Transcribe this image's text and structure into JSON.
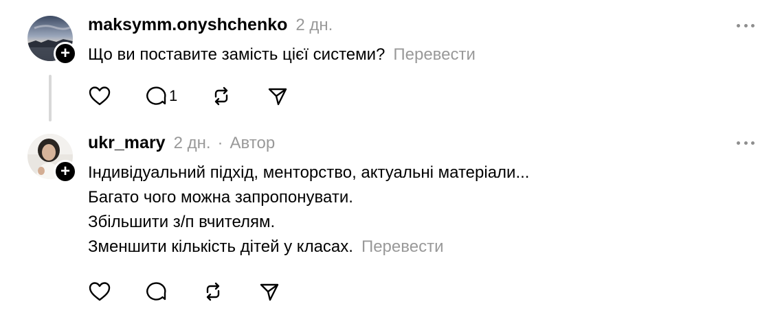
{
  "posts": [
    {
      "username": "maksymm.onyshchenko",
      "time": "2 дн.",
      "lines": [
        "Що ви поставите замість цієї системи?"
      ],
      "translate": "Перевести",
      "reply_count": "1",
      "avatar": "sky-landscape-avatar"
    },
    {
      "username": "ukr_mary",
      "time": "2 дн.",
      "separator": "·",
      "author_label": "Автор",
      "lines": [
        "Індивідуальний підхід, менторство, актуальні матеріали...",
        "Багато чого можна запропонувати.",
        "Збільшити з/п вчителям.",
        "Зменшити кількість дітей у класах."
      ],
      "translate": "Перевести",
      "avatar": "woman-portrait-avatar"
    }
  ],
  "icons": {
    "like": "heart-icon",
    "reply": "comment-icon",
    "repost": "repost-icon",
    "share": "send-icon",
    "more": "more-options-icon",
    "follow": "plus-icon"
  },
  "colors": {
    "text": "#000000",
    "muted": "#999999",
    "thread_line": "#d8d8d8"
  }
}
